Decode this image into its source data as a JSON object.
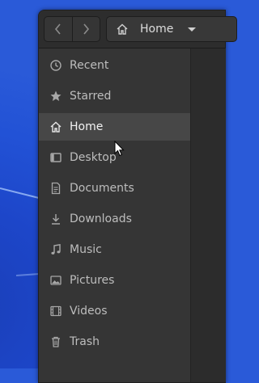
{
  "header": {
    "back_icon": "chevron-left-icon",
    "forward_icon": "chevron-right-icon",
    "location": "Home"
  },
  "sidebar": {
    "items": [
      {
        "label": "Recent",
        "icon": "clock-icon"
      },
      {
        "label": "Starred",
        "icon": "star-icon"
      },
      {
        "label": "Home",
        "icon": "home-icon",
        "active": true
      },
      {
        "label": "Desktop",
        "icon": "desktop-icon"
      },
      {
        "label": "Documents",
        "icon": "document-icon"
      },
      {
        "label": "Downloads",
        "icon": "download-icon"
      },
      {
        "label": "Music",
        "icon": "music-icon"
      },
      {
        "label": "Pictures",
        "icon": "picture-icon"
      },
      {
        "label": "Videos",
        "icon": "video-icon"
      },
      {
        "label": "Trash",
        "icon": "trash-icon"
      }
    ]
  },
  "colors": {
    "desktop_bg": "#2252d6",
    "sidebar_bg": "#353535",
    "active_row": "#474747",
    "text": "#bdbdbd"
  }
}
